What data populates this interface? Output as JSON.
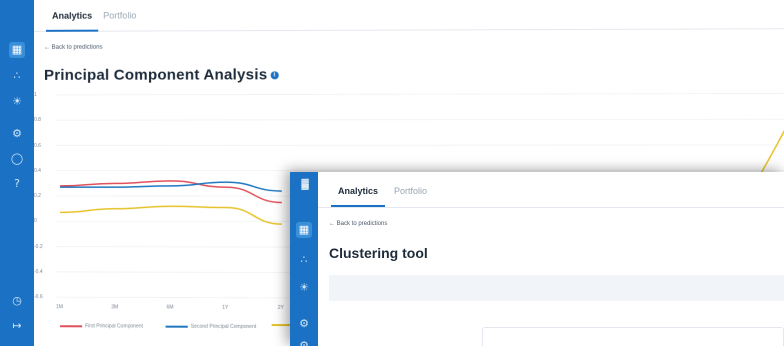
{
  "back_window": {
    "tabs": [
      {
        "label": "Analytics",
        "active": true
      },
      {
        "label": "Portfolio",
        "active": false
      }
    ],
    "back_link": "← Back to predictions",
    "title": "Principal Component Analysis",
    "info_icon": "info-icon",
    "sidebar_icons": [
      "grid-icon",
      "chart-icon",
      "lightbulb-icon",
      "settings-icon",
      "chat-icon",
      "help-icon",
      "clock-icon",
      "logout-icon"
    ]
  },
  "front_window": {
    "tabs": [
      {
        "label": "Analytics",
        "active": true
      },
      {
        "label": "Portfolio",
        "active": false
      }
    ],
    "back_link": "← Back to predictions",
    "title": "Clustering tool",
    "sidebar_icons": [
      "logo-icon",
      "grid-icon",
      "chart-icon",
      "lightbulb-icon",
      "settings-icon",
      "settings-icon"
    ]
  },
  "chart_data": {
    "type": "line",
    "categories": [
      "1M",
      "3M",
      "6M",
      "1Y",
      "2Y"
    ],
    "y_ticks": [
      "1",
      "0.8",
      "0.6",
      "0.4",
      "0.2",
      "0",
      "-0.2",
      "-0.4",
      "-0.6"
    ],
    "ylim": [
      -0.6,
      1
    ],
    "grid": true,
    "legend_position": "bottom-left",
    "series": [
      {
        "name": "First Principal Component",
        "color": "#e0505a",
        "values": [
          0.28,
          0.3,
          0.32,
          0.27,
          0.15
        ]
      },
      {
        "name": "Second Principal Component",
        "color": "#1f77c0",
        "values": [
          0.27,
          0.27,
          0.28,
          0.31,
          0.24
        ]
      },
      {
        "name": "",
        "color": "#e6c229",
        "values": [
          0.07,
          0.1,
          0.12,
          0.11,
          -0.02
        ]
      }
    ]
  }
}
